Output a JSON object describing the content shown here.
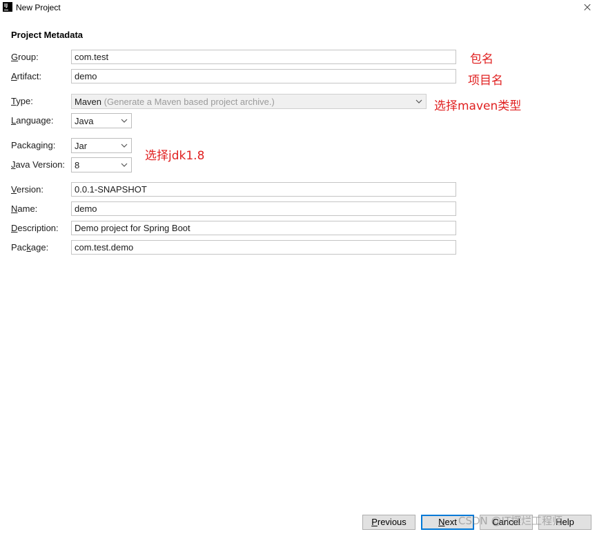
{
  "window": {
    "title": "New Project",
    "app_icon_text": "IJ"
  },
  "section_title": "Project Metadata",
  "fields": {
    "group": {
      "label": "Group:",
      "mnemonic": "G",
      "rest": "roup:",
      "value": "com.test"
    },
    "artifact": {
      "label": "Artifact:",
      "mnemonic": "A",
      "rest": "rtifact:",
      "value": "demo"
    },
    "type": {
      "label": "Type:",
      "mnemonic": "T",
      "rest": "ype:",
      "value": "Maven",
      "hint": "(Generate a Maven based project archive.)"
    },
    "language": {
      "label": "Language:",
      "mnemonic": "L",
      "rest": "anguage:",
      "value": "Java"
    },
    "packaging": {
      "label": "Packaging:",
      "pre": "Packa",
      "mnemonic": "g",
      "rest": "ing:",
      "value": "Jar"
    },
    "java_version": {
      "label": "Java Version:",
      "mnemonic": "J",
      "rest": "ava Version:",
      "value": "8"
    },
    "version": {
      "label": "Version:",
      "mnemonic": "V",
      "rest": "ersion:",
      "value": "0.0.1-SNAPSHOT"
    },
    "name": {
      "label": "Name:",
      "mnemonic": "N",
      "rest": "ame:",
      "value": "demo"
    },
    "description": {
      "label": "Description:",
      "mnemonic": "D",
      "rest": "escription:",
      "value": "Demo project for Spring Boot"
    },
    "package": {
      "label": "Package:",
      "pre": "Pac",
      "mnemonic": "k",
      "rest": "age:",
      "value": "com.test.demo"
    }
  },
  "annotations": {
    "group": "包名",
    "artifact": "项目名",
    "type": "选择maven类型",
    "java": "选择jdk1.8"
  },
  "buttons": {
    "previous": {
      "label": "Previous",
      "mnemonic": "P",
      "rest": "revious"
    },
    "next": {
      "label": "Next",
      "mnemonic": "N",
      "rest": "ext"
    },
    "cancel": {
      "label": "Cancel"
    },
    "help": {
      "label": "Help"
    }
  },
  "watermark": "CSDN @IT摆烂工程师",
  "colors": {
    "annotation": "#e02020",
    "default_button_border": "#0078d7"
  }
}
